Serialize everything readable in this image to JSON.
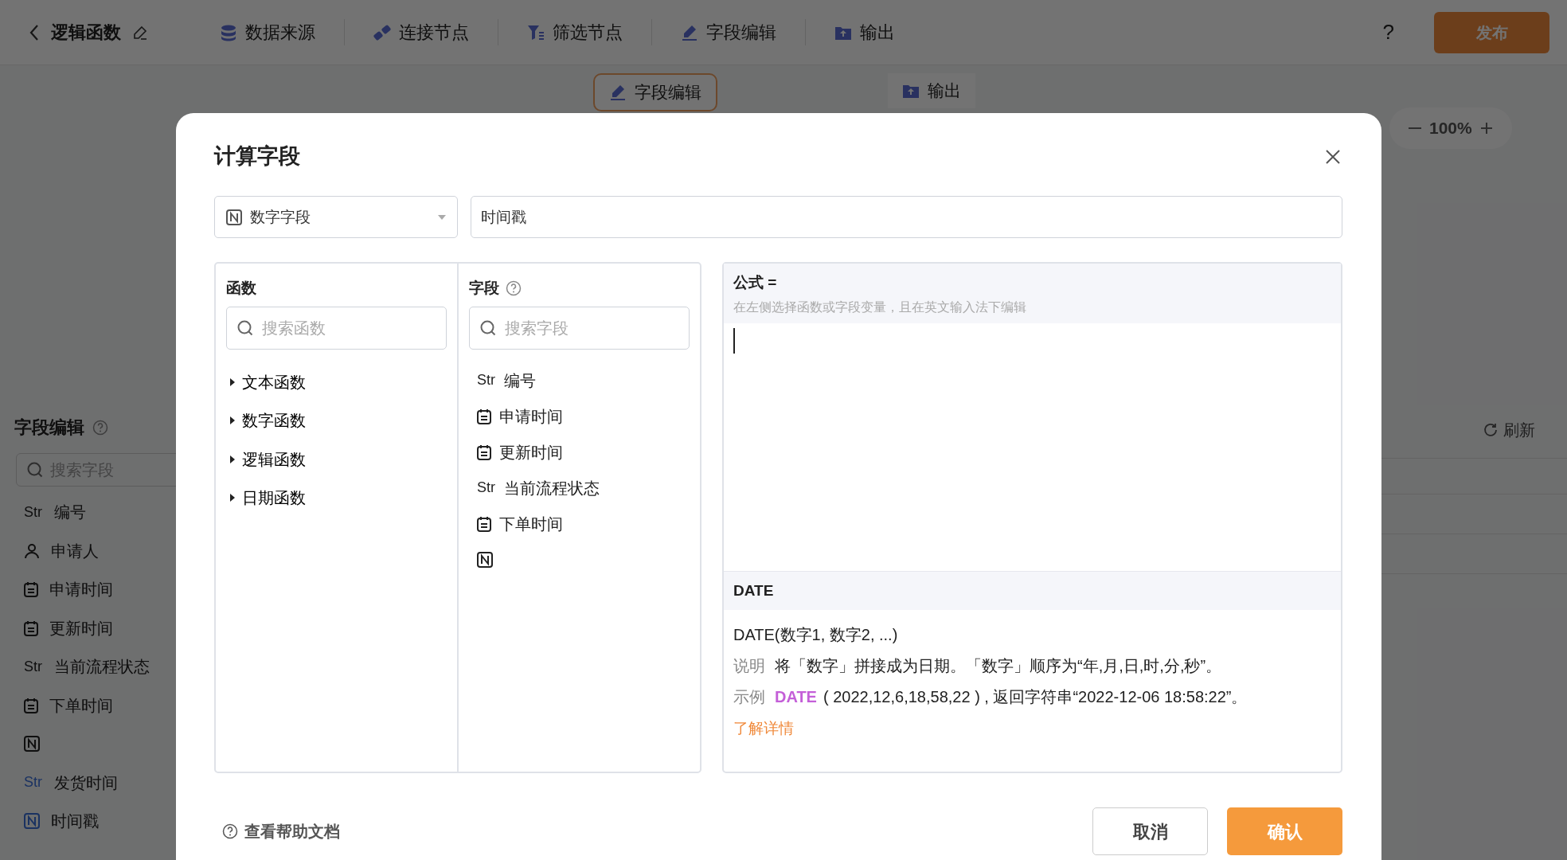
{
  "app_bar": {
    "title": "逻辑函数",
    "steps": [
      {
        "label": "数据来源",
        "kind": "database"
      },
      {
        "label": "连接节点",
        "kind": "link"
      },
      {
        "label": "筛选节点",
        "kind": "filter"
      },
      {
        "label": "字段编辑",
        "kind": "edit"
      },
      {
        "label": "输出",
        "kind": "output"
      }
    ],
    "help": "?",
    "publish": "发布"
  },
  "canvas": {
    "nodes": [
      {
        "label": "字段编辑",
        "kind": "edit"
      },
      {
        "label": "输出",
        "kind": "output"
      }
    ],
    "zoom": "100%"
  },
  "side_panel": {
    "title": "字段编辑",
    "search_placeholder": "搜索字段",
    "fields": [
      {
        "kind": "str",
        "tag": "Str",
        "label": "编号",
        "highlighted": false
      },
      {
        "kind": "person",
        "label": "申请人",
        "highlighted": false
      },
      {
        "kind": "date",
        "label": "申请时间",
        "highlighted": false
      },
      {
        "kind": "date",
        "label": "更新时间",
        "highlighted": false
      },
      {
        "kind": "str",
        "tag": "Str",
        "label": "当前流程状态",
        "highlighted": false
      },
      {
        "kind": "date",
        "label": "下单时间",
        "highlighted": false
      },
      {
        "kind": "number",
        "highlighted": false
      },
      {
        "kind": "str",
        "tag": "Str",
        "label": "发货时间",
        "highlighted": true
      },
      {
        "kind": "number",
        "label": "时间戳",
        "highlighted": true
      }
    ],
    "refresh": "刷新"
  },
  "dialog": {
    "title": "计算字段",
    "type_select": {
      "value": "数字字段"
    },
    "name_input": {
      "value": "时间戳"
    },
    "functions": {
      "title": "函数",
      "search_placeholder": "搜索函数",
      "groups": [
        {
          "label": "文本函数",
          "expanded": false
        },
        {
          "label": "数字函数",
          "expanded": false
        },
        {
          "label": "逻辑函数",
          "expanded": false
        },
        {
          "label": "日期函数",
          "expanded": false
        }
      ]
    },
    "fields": {
      "title": "字段",
      "search_placeholder": "搜索字段",
      "items": [
        {
          "kind": "str",
          "tag": "Str",
          "label": "编号"
        },
        {
          "kind": "date",
          "label": "申请时间"
        },
        {
          "kind": "date",
          "label": "更新时间"
        },
        {
          "kind": "str",
          "tag": "Str",
          "label": "当前流程状态"
        },
        {
          "kind": "date",
          "label": "下单时间"
        },
        {
          "kind": "number"
        }
      ]
    },
    "formula": {
      "label": "公式 =",
      "hint": "在左侧选择函数或字段变量，且在英文输入法下编辑"
    },
    "doc": {
      "name": "DATE",
      "signature": "DATE(数字1, 数字2, ...)",
      "description_label": "说明",
      "description": "将「数字」拼接成为日期。「数字」顺序为“年,月,日,时,分,秒”。",
      "example_label": "示例",
      "example_function": "DATE",
      "example_rest": "( 2022,12,6,18,58,22 ) , 返回字符串“2022-12-06 18:58:22”。",
      "learn_more": "了解详情"
    },
    "footer": {
      "help_link": "查看帮助文档",
      "cancel": "取消",
      "confirm": "确认"
    }
  }
}
